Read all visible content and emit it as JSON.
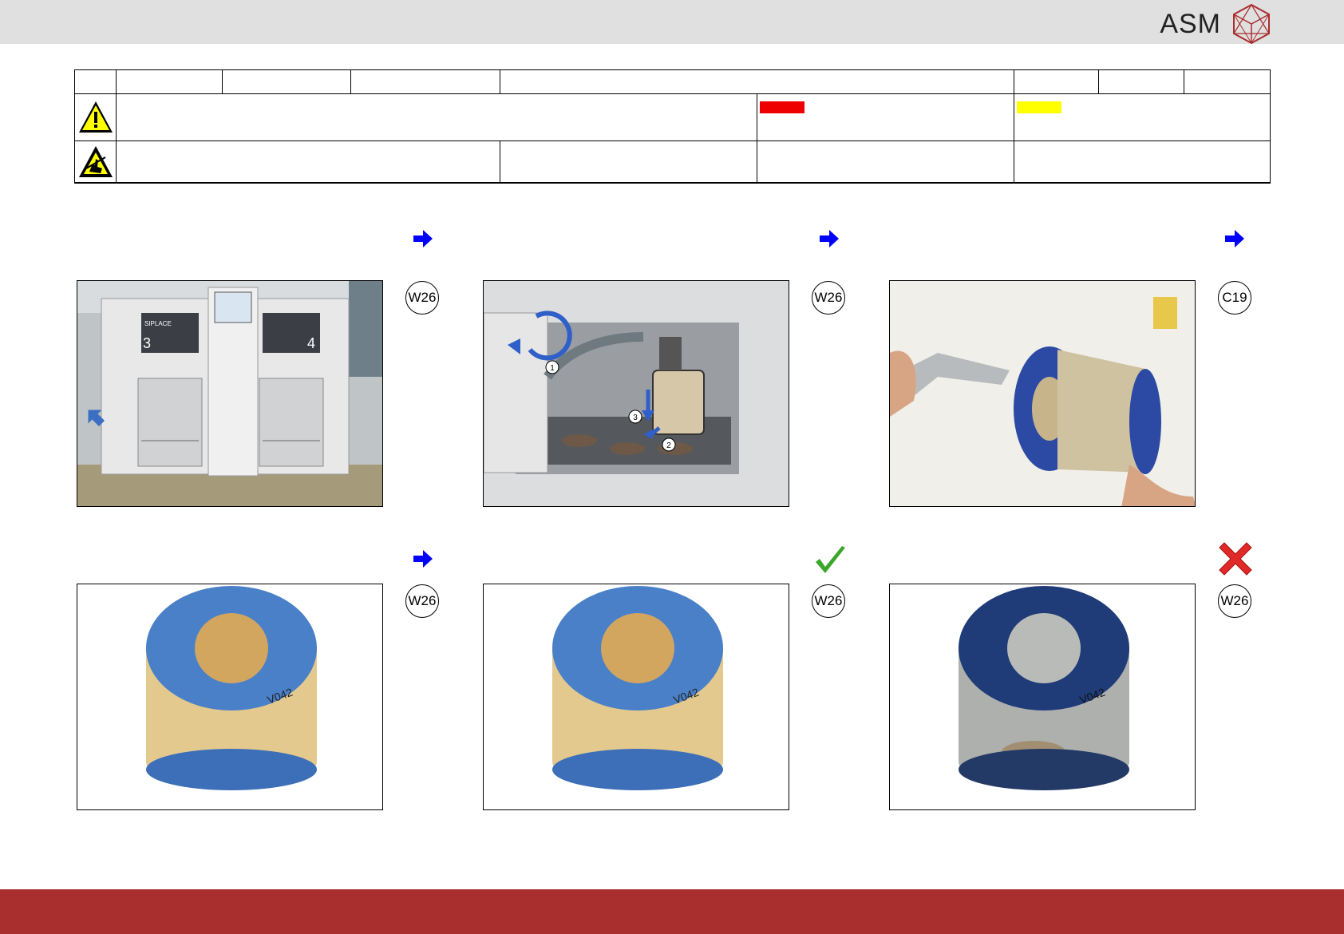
{
  "brand": {
    "name": "ASM",
    "logo_icon": "asm-crystal-logo"
  },
  "header_table": {
    "warning_icon": "warning-triangle-icon",
    "esd_icon": "esd-hand-icon",
    "colors": {
      "red_bar": "#ee0000",
      "yellow_bar": "#ffff00"
    }
  },
  "steps": [
    {
      "id": "step-1",
      "marker": "next-arrow-icon",
      "badge": "W26",
      "photo": "placement-machine-front"
    },
    {
      "id": "step-2",
      "marker": "next-arrow-icon",
      "badge": "W26",
      "photo": "filter-housing-removal",
      "callouts": [
        "1",
        "2",
        "3"
      ]
    },
    {
      "id": "step-3",
      "marker": "next-arrow-icon",
      "badge": "C19",
      "photo": "blowing-out-filter"
    },
    {
      "id": "step-4",
      "marker": "next-arrow-icon",
      "badge": "W26",
      "photo": "clean-filter"
    },
    {
      "id": "step-5",
      "marker": "ok-check-icon",
      "badge": "W26",
      "photo": "clean-filter-ok"
    },
    {
      "id": "step-6",
      "marker": "not-ok-cross-icon",
      "badge": "W26",
      "photo": "dirty-filter-replace"
    }
  ],
  "machine_labels": {
    "left": "3",
    "right": "4",
    "brand_left": "SIPLACE"
  },
  "filter_print": "V042"
}
